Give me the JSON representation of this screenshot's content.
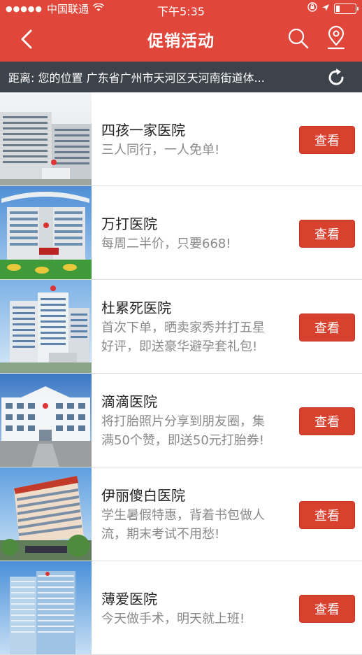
{
  "status_bar": {
    "carrier": "中国联通",
    "time": "下午5:35"
  },
  "nav": {
    "title": "促销活动"
  },
  "location": {
    "text": "距离:  您的位置 广东省广州市天河区天河南街道体..."
  },
  "items": [
    {
      "name": "四孩一家医院",
      "desc": "三人同行，一人免单!",
      "button": "查看"
    },
    {
      "name": "万打医院",
      "desc": "每周二半价，只要668!",
      "button": "查看"
    },
    {
      "name": "杜累死医院",
      "desc": "首次下单，晒卖家秀并打五星好评，即送豪华避孕套礼包!",
      "button": "查看"
    },
    {
      "name": "滴滴医院",
      "desc": "将打胎照片分享到朋友圈，集满50个赞，即送50元打胎券!",
      "button": "查看"
    },
    {
      "name": "伊丽傻白医院",
      "desc": "学生暑假特惠，背着书包做人流，期末考试不用愁!",
      "button": "查看"
    },
    {
      "name": "薄爱医院",
      "desc": "今天做手术，明天就上班!",
      "button": "查看"
    }
  ]
}
